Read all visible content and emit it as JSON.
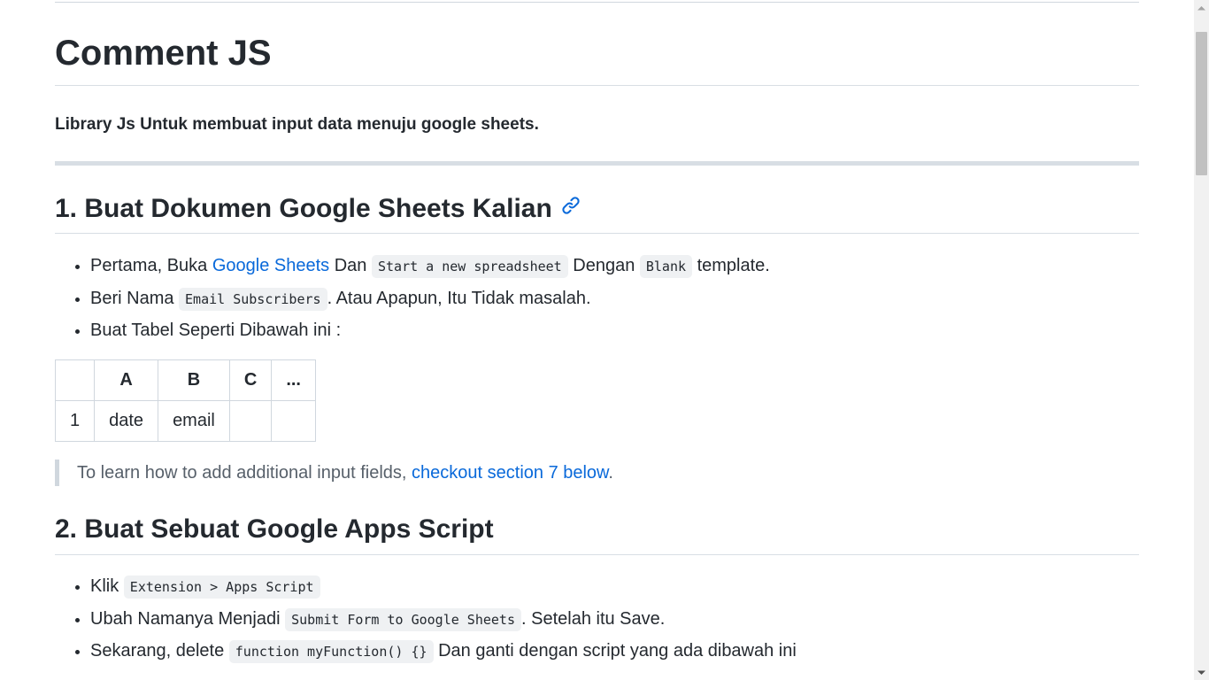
{
  "title": "Comment JS",
  "subtitle": "Library Js Untuk membuat input data menuju google sheets.",
  "section1": {
    "heading": "1. Buat Dokumen Google Sheets Kalian",
    "items": [
      {
        "pre": "Pertama, Buka ",
        "link": "Google Sheets",
        "mid": " Dan ",
        "code1": "Start a new spreadsheet",
        "mid2": " Dengan ",
        "code2": "Blank",
        "post": " template."
      },
      {
        "pre": "Beri Nama ",
        "code": "Email Subscribers",
        "post": ". Atau Apapun, Itu Tidak masalah."
      },
      {
        "text": "Buat Tabel Seperti Dibawah ini :"
      }
    ],
    "table": {
      "headers": [
        "",
        "A",
        "B",
        "C",
        "..."
      ],
      "rows": [
        [
          "1",
          "date",
          "email",
          "",
          ""
        ]
      ]
    },
    "note": {
      "pre": "To learn how to add additional input fields, ",
      "link": "checkout section 7 below",
      "post": "."
    }
  },
  "section2": {
    "heading": "2. Buat Sebuat Google Apps Script",
    "items": [
      {
        "pre": "Klik ",
        "code": "Extension > Apps Script",
        "post": ""
      },
      {
        "pre": "Ubah Namanya Menjadi ",
        "code": "Submit Form to Google Sheets",
        "post": ". Setelah itu Save."
      },
      {
        "pre": "Sekarang, delete ",
        "code": "function myFunction() {}",
        "post": " Dan ganti dengan script yang ada dibawah ini"
      }
    ]
  },
  "colors": {
    "link": "#0969da",
    "text": "#24292f",
    "muted": "#57606a"
  }
}
